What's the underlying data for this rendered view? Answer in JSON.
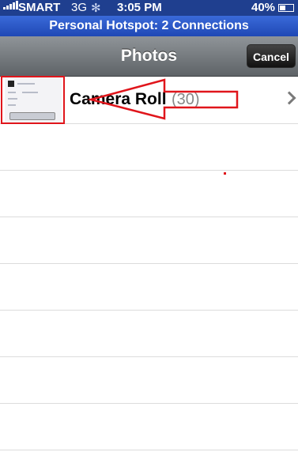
{
  "status_bar": {
    "carrier": "SMART",
    "network": "3G",
    "spinner": "✻",
    "time": "3:05 PM",
    "battery_percent": "40%"
  },
  "hotspot_banner": "Personal Hotspot: 2 Connections",
  "nav": {
    "title": "Photos",
    "cancel_label": "Cancel"
  },
  "albums": [
    {
      "name": "Camera Roll",
      "count": "(30)"
    }
  ],
  "colors": {
    "status_bar_bg": "#1f3f8f",
    "hotspot_bg": "#2f5bd0",
    "annotation_red": "#e0151b"
  }
}
